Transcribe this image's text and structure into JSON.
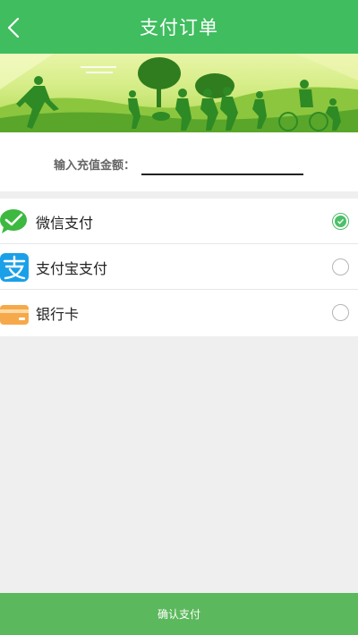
{
  "header": {
    "title": "支付订单"
  },
  "amount": {
    "label": "输入充值金额：",
    "value": "",
    "placeholder": ""
  },
  "methods": [
    {
      "name": "微信支付",
      "icon": "wechat-icon",
      "selected": true
    },
    {
      "name": "支付宝支付",
      "icon": "alipay-icon",
      "selected": false
    },
    {
      "name": "银行卡",
      "icon": "bank-card-icon",
      "selected": false
    }
  ],
  "footer": {
    "confirm_label": "确认支付"
  },
  "colors": {
    "primary": "#3fbd5f",
    "confirm": "#5cb85c",
    "background": "#efefef"
  }
}
